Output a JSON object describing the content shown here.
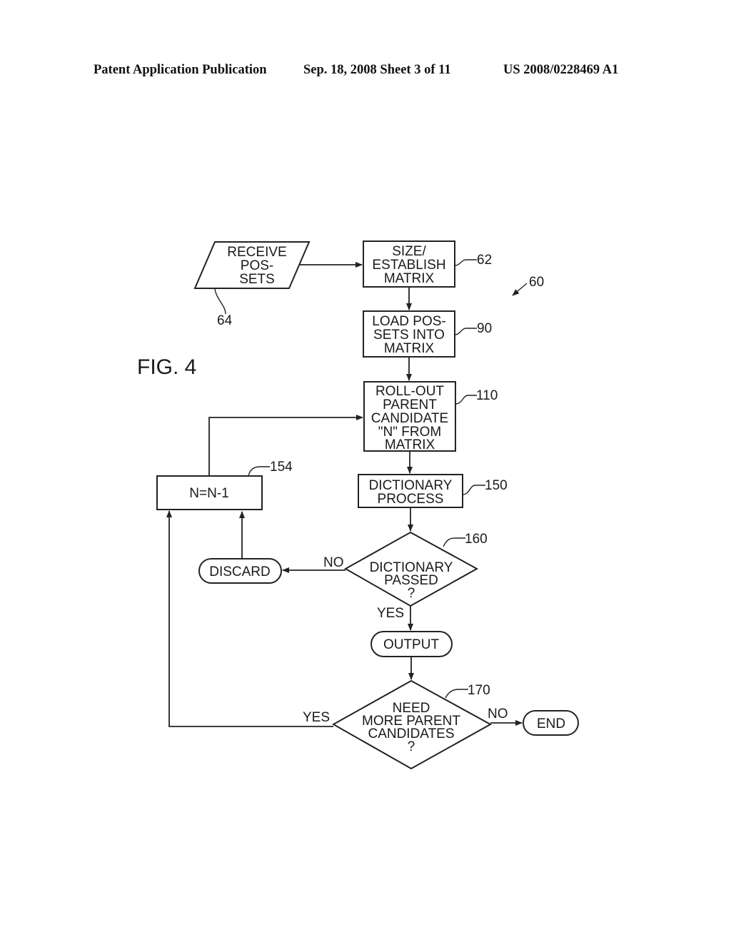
{
  "header": {
    "publication": "Patent Application Publication",
    "date_sheet": "Sep. 18, 2008   Sheet 3 of 11",
    "number": "US 2008/0228469 A1"
  },
  "figure": {
    "label": "FIG. 4",
    "overall_ref": "60"
  },
  "nodes": {
    "receive": {
      "type": "parallelogram",
      "lines": [
        "RECEIVE",
        "POS-",
        "SETS"
      ],
      "ref": "64"
    },
    "size": {
      "type": "process",
      "lines": [
        "SIZE/",
        "ESTABLISH",
        "MATRIX"
      ],
      "ref": "62"
    },
    "load": {
      "type": "process",
      "lines": [
        "LOAD POS-",
        "SETS INTO",
        "MATRIX"
      ],
      "ref": "90"
    },
    "rollout": {
      "type": "process",
      "lines": [
        "ROLL-OUT",
        "PARENT",
        "CANDIDATE",
        "\"N\" FROM",
        "MATRIX"
      ],
      "ref": "110"
    },
    "dictionary": {
      "type": "process",
      "lines": [
        "DICTIONARY",
        "PROCESS"
      ],
      "ref": "150"
    },
    "decrement": {
      "type": "process",
      "lines": [
        "N=N-1"
      ],
      "ref": "154"
    },
    "passed": {
      "type": "decision",
      "lines": [
        "DICTIONARY",
        "PASSED",
        "?"
      ],
      "ref": "160"
    },
    "discard": {
      "type": "terminal",
      "lines": [
        "DISCARD"
      ]
    },
    "output": {
      "type": "terminal",
      "lines": [
        "OUTPUT"
      ]
    },
    "more": {
      "type": "decision",
      "lines": [
        "NEED",
        "MORE PARENT",
        "CANDIDATES",
        "?"
      ],
      "ref": "170"
    },
    "end": {
      "type": "terminal",
      "lines": [
        "END"
      ]
    }
  },
  "edge_labels": {
    "passed_no": "NO",
    "passed_yes": "YES",
    "more_yes": "YES",
    "more_no": "NO"
  }
}
